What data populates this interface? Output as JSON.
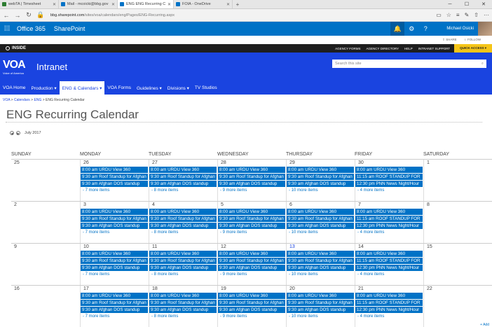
{
  "browser": {
    "tabs": [
      {
        "label": "webTA | Timesheet",
        "color": "#2e7d32"
      },
      {
        "label": "Mail - mcoicki@bbg.gov",
        "color": "#0072c6"
      },
      {
        "label": "ENG ENG Recurring Cal",
        "color": "#0072c6",
        "active": true
      },
      {
        "label": "FOIA - OneDrive",
        "color": "#0072c6"
      }
    ],
    "url_host": "bbg.sharepoint.com",
    "url_path": "/sites/voa/calendars/eng/Pages/ENG-Recurring.aspx"
  },
  "suite": {
    "o365": "Office 365",
    "app": "SharePoint",
    "user": "Michael Osicki"
  },
  "share": {
    "share": "SHARE",
    "follow": "FOLLOW"
  },
  "inside": {
    "logo": "INSIDE",
    "links": [
      "AGENCY FORMS",
      "AGENCY DIRECTORY",
      "HELP",
      "INTRANET SUPPORT"
    ],
    "quick_access": "QUICK ACCESS ▾"
  },
  "header": {
    "logo": "VOA",
    "logo_sub": "Voice of America",
    "title": "Intranet",
    "search_placeholder": "Search this site"
  },
  "nav": [
    {
      "label": "VOA Home"
    },
    {
      "label": "Production ▾"
    },
    {
      "label": "ENG & Calendars ▾",
      "active": true
    },
    {
      "label": "VOA Forms"
    },
    {
      "label": "Guidelines ▾"
    },
    {
      "label": "Divisions ▾"
    },
    {
      "label": "TV Studios"
    }
  ],
  "breadcrumb": [
    "VOA",
    "Calendars",
    "ENG",
    "ENG Recurring Calendar"
  ],
  "page_title": "ENG Recurring Calendar",
  "month": "July 2017",
  "days": [
    "SUNDAY",
    "MONDAY",
    "TUESDAY",
    "WEDNESDAY",
    "THURSDAY",
    "FRIDAY",
    "SATURDAY"
  ],
  "weeks": [
    {
      "dates": [
        "25",
        "26",
        "27",
        "28",
        "29",
        "30",
        "1"
      ],
      "cells": [
        {
          "events": [],
          "more": ""
        },
        {
          "events": [
            "8:00 am URDU View 360",
            "9:30 am Roof Standup for Afghan",
            "9:30 am Afghan DOS standup"
          ],
          "more": "- 7 more items"
        },
        {
          "events": [
            "8:00 am URDU View 360",
            "9:30 am Roof Standup for Afghan",
            "9:30 am Afghan DOS standup"
          ],
          "more": "- 8 more items"
        },
        {
          "events": [
            "8:00 am URDU View 360",
            "9:30 am Roof Standup for Afghan",
            "9:30 am Afghan DOS standup"
          ],
          "more": "- 9 more items"
        },
        {
          "events": [
            "8:00 am URDU View 360",
            "9:30 am Roof Standup for Afghan",
            "9:30 am Afghan DOS standup"
          ],
          "more": "- 10 more items"
        },
        {
          "events": [
            "8:00 am URDU View 360",
            "11:15 am ROOF STANDUP FOR",
            "12:30 pm PNN News Night/Hour"
          ],
          "more": "- 4 more items"
        },
        {
          "events": [],
          "more": ""
        }
      ]
    },
    {
      "dates": [
        "2",
        "3",
        "4",
        "5",
        "6",
        "7",
        "8"
      ],
      "cells": [
        {
          "events": [],
          "more": ""
        },
        {
          "events": [
            "8:00 am URDU View 360",
            "9:30 am Roof Standup for Afghan",
            "9:30 am Afghan DOS standup"
          ],
          "more": "- 7 more items"
        },
        {
          "events": [
            "8:00 am URDU View 360",
            "9:30 am Roof Standup for Afghan",
            "9:30 am Afghan DOS standup"
          ],
          "more": "- 8 more items"
        },
        {
          "events": [
            "8:00 am URDU View 360",
            "9:30 am Roof Standup for Afghan",
            "9:30 am Afghan DOS standup"
          ],
          "more": "- 9 more items"
        },
        {
          "events": [
            "8:00 am URDU View 360",
            "9:30 am Roof Standup for Afghan",
            "9:30 am Afghan DOS standup"
          ],
          "more": "- 10 more items"
        },
        {
          "events": [
            "8:00 am URDU View 360",
            "11:15 am ROOF STANDUP FOR",
            "12:30 pm PNN News Night/Hour"
          ],
          "more": "- 4 more items"
        },
        {
          "events": [],
          "more": ""
        }
      ]
    },
    {
      "dates": [
        "9",
        "10",
        "11",
        "12",
        "13",
        "14",
        "15"
      ],
      "today": 4,
      "cells": [
        {
          "events": [],
          "more": ""
        },
        {
          "events": [
            "8:00 am URDU View 360",
            "9:30 am Roof Standup for Afghan",
            "9:30 am Afghan DOS standup"
          ],
          "more": "- 7 more items"
        },
        {
          "events": [
            "8:00 am URDU View 360",
            "9:30 am Roof Standup for Afghan",
            "9:30 am Afghan DOS standup"
          ],
          "more": "- 8 more items"
        },
        {
          "events": [
            "8:00 am URDU View 360",
            "9:30 am Roof Standup for Afghan",
            "9:30 am Afghan DOS standup"
          ],
          "more": "- 9 more items"
        },
        {
          "events": [
            "8:00 am URDU View 360",
            "9:30 am Roof Standup for Afghan",
            "9:30 am Afghan DOS standup"
          ],
          "more": "- 10 more items"
        },
        {
          "events": [
            "8:00 am URDU View 360",
            "11:15 am ROOF STANDUP FOR",
            "12:30 pm PNN News Night/Hour"
          ],
          "more": "- 4 more items"
        },
        {
          "events": [],
          "more": ""
        }
      ]
    },
    {
      "dates": [
        "16",
        "17",
        "18",
        "19",
        "20",
        "21",
        "22"
      ],
      "cells": [
        {
          "events": [],
          "more": ""
        },
        {
          "events": [
            "8:00 am URDU View 360",
            "9:30 am Roof Standup for Afghan",
            "9:30 am Afghan DOS standup"
          ],
          "more": "- 7 more items"
        },
        {
          "events": [
            "8:00 am URDU View 360",
            "9:30 am Roof Standup for Afghan",
            "9:30 am Afghan DOS standup"
          ],
          "more": "- 8 more items"
        },
        {
          "events": [
            "8:00 am URDU View 360",
            "9:30 am Roof Standup for Afghan",
            "9:30 am Afghan DOS standup"
          ],
          "more": "- 9 more items"
        },
        {
          "events": [
            "8:00 am URDU View 360",
            "9:30 am Roof Standup for Afghan",
            "9:30 am Afghan DOS standup"
          ],
          "more": "- 10 more items"
        },
        {
          "events": [
            "8:00 am URDU View 360",
            "11:15 am ROOF STANDUP FOR",
            "12:30 pm PNN News Night/Hour"
          ],
          "more": "- 4 more items"
        },
        {
          "events": [],
          "more": ""
        }
      ]
    }
  ],
  "add_label": "+ Add"
}
